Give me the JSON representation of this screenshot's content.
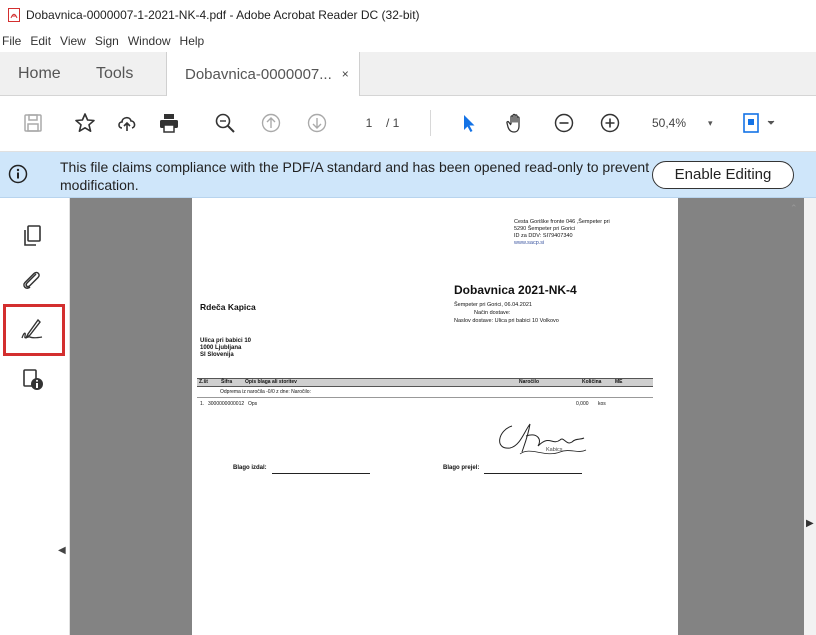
{
  "window": {
    "title": "Dobavnica-0000007-1-2021-NK-4.pdf - Adobe Acrobat Reader DC (32-bit)"
  },
  "menu": [
    "File",
    "Edit",
    "View",
    "Sign",
    "Window",
    "Help"
  ],
  "tabs": {
    "home": "Home",
    "tools": "Tools",
    "doc": "Dobavnica-0000007...",
    "close": "×"
  },
  "toolbar": {
    "page_current": "1",
    "page_total": "/ 1",
    "zoom": "50,4%",
    "zoom_caret": "▾",
    "icons": [
      "save-icon",
      "star-icon",
      "upload-icon",
      "print-icon",
      "zoom-search-icon",
      "page-up-icon",
      "page-down-icon",
      "select-cursor-icon",
      "hand-icon",
      "zoom-out-icon",
      "zoom-in-icon",
      "page-fit-icon"
    ],
    "accent_color": "#1473e6"
  },
  "banner": {
    "message": "This file claims compliance with the PDF/A standard and has been opened read-only to prevent modification.",
    "button": "Enable Editing",
    "background": "#cfe6fa"
  },
  "rail": {
    "icons": [
      "pages-icon",
      "attachment-icon",
      "signature-icon",
      "protect-icon"
    ],
    "highlight_color": "#d32f2f"
  },
  "document": {
    "sender_address_1": "Cesta Goriške fronte 046 ,Šempeter pri",
    "sender_address_2": "5290 Šempeter pri Gorici",
    "sender_vat": "ID za DDV: SI79407340",
    "sender_web": "www.sacp.si",
    "title": "Dobavnica 2021-NK-4",
    "place_date": "Šempeter pri Gorici, 06.04.2021",
    "delivery_method": "Način dostave:",
    "delivery_address": "Naslov dostave: Ulica pri babici 10 Volkovo",
    "customer_name": "Rdeča Kapica",
    "customer_street": "Ulica pri babici 10",
    "customer_city": "1000 Ljubljana",
    "customer_country": "SI Slovenija",
    "table_headers": [
      "Z.št",
      "Šifra",
      "Opis blaga ali storitev",
      "Naročilo",
      "Količina",
      "ME"
    ],
    "order_note": "Odprema iz naročila -0/0  z dne:   Naročilo:",
    "row": {
      "no": "1.",
      "code": "3000000000012",
      "desc": "Ops",
      "qty": "0,000",
      "unit": "kos"
    },
    "issued_label": "Blago izdal:",
    "received_label": "Blago prejel:",
    "signature_name": "Kabics"
  },
  "nav": {
    "left_arrow": "◀",
    "right_arrow": "▶",
    "scroll_up": "⌃"
  }
}
